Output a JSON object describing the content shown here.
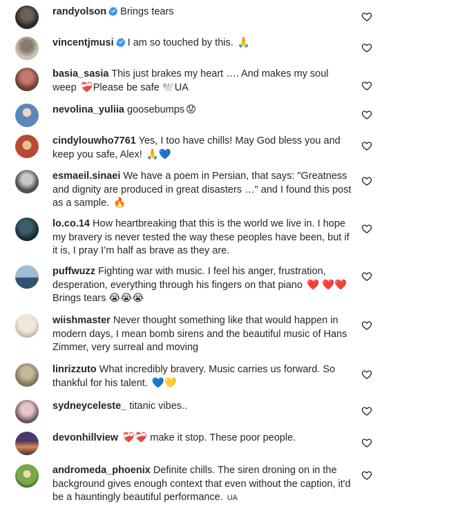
{
  "comments": [
    {
      "username": "randyolson",
      "verified": true,
      "text": "Brings tears",
      "emojis": "",
      "avatar_color": "#6b6055",
      "avatar_color2": "#2f2a26"
    },
    {
      "username": "vincentjmusi",
      "verified": true,
      "text": "I am so touched by this.",
      "emojis": "🙏",
      "avatar_color": "#8a7a68",
      "avatar_color2": "#c9c2b5"
    },
    {
      "username": "basia_sasia",
      "verified": false,
      "text": "This just brakes my heart …. And makes my soul weep",
      "emojis": "❤️‍🩹Please be safe 🕊️UA",
      "avatar_color": "#c57a6b",
      "avatar_color2": "#6b3b32"
    },
    {
      "username": "nevolina_yuliia",
      "verified": false,
      "text": "goosebumps",
      "emojis": "😟",
      "avatar_color": "#5e86b8",
      "avatar_color2": "#1f3c63"
    },
    {
      "username": "cindylouwho7761",
      "verified": false,
      "text": "Yes, I too have chills! May God bless you and keep you safe, Alex!",
      "emojis": "🙏💙",
      "avatar_color": "#b84a35",
      "avatar_color2": "#e4c38d"
    },
    {
      "username": "esmaeil.sinaei",
      "verified": false,
      "text": "We have a poem in Persian, that says: \"Greatness and dignity are produced in great disasters …\" and I found this post as a sample.",
      "emojis": "🔥",
      "avatar_color": "#9a9a9a",
      "avatar_color2": "#505050"
    },
    {
      "username": "lo.co.14",
      "verified": false,
      "text": "How heartbreaking that this is the world we live in. I hope my bravery is never tested the way these peoples have been, but if it is, I pray I’m half as brave as they are.",
      "emojis": "",
      "avatar_color": "#3b5f6b",
      "avatar_color2": "#13232a"
    },
    {
      "username": "puffwuzz",
      "verified": false,
      "text": "Fighting war with music. I feel his anger, frustration, desperation, everything through his fingers on that piano",
      "emojis": "❤️ ❤️❤️ Brings tears 😭😭😭",
      "avatar_color": "#7fa1bd",
      "avatar_color2": "#30526e"
    },
    {
      "username": "wiishmaster",
      "verified": false,
      "text": "Never thought something like that would happen in modern days, I mean bomb sirens and the beautiful music of Hans Zimmer, very surreal and moving",
      "emojis": "",
      "avatar_color": "#efe6dc",
      "avatar_color2": "#b9a898"
    },
    {
      "username": "linrizzuto",
      "verified": false,
      "text": "What incredibly bravery. Music carries us forward. So thankful for his talent.",
      "emojis": "💙💛",
      "avatar_color": "#7d7460",
      "avatar_color2": "#c8b899"
    },
    {
      "username": "sydneyceleste_",
      "verified": false,
      "text": "titanic vibes..",
      "emojis": "",
      "avatar_color": "#c9a3a9",
      "avatar_color2": "#5e4a4f"
    },
    {
      "username": "devonhillview",
      "verified": false,
      "text": "make it stop. These poor people.",
      "emojis": "❤️‍🩹❤️‍🩹",
      "avatar_color": "#d88a4b",
      "avatar_color2": "#4a3a6a"
    },
    {
      "username": "andromeda_phoenix",
      "verified": false,
      "text": "Definite chills. The siren droning on in the background gives enough context that even without the caption, it'd be a hauntingly beautiful performance.",
      "emojis": "UA",
      "avatar_color": "#7aa84a",
      "avatar_color2": "#2d4a1f"
    }
  ],
  "colors": {
    "text": "#262626",
    "verified": "#3897f0",
    "heart_outline": "#262626"
  },
  "icons": {
    "like": "heart-outline-icon",
    "verified": "verified-badge-icon"
  }
}
